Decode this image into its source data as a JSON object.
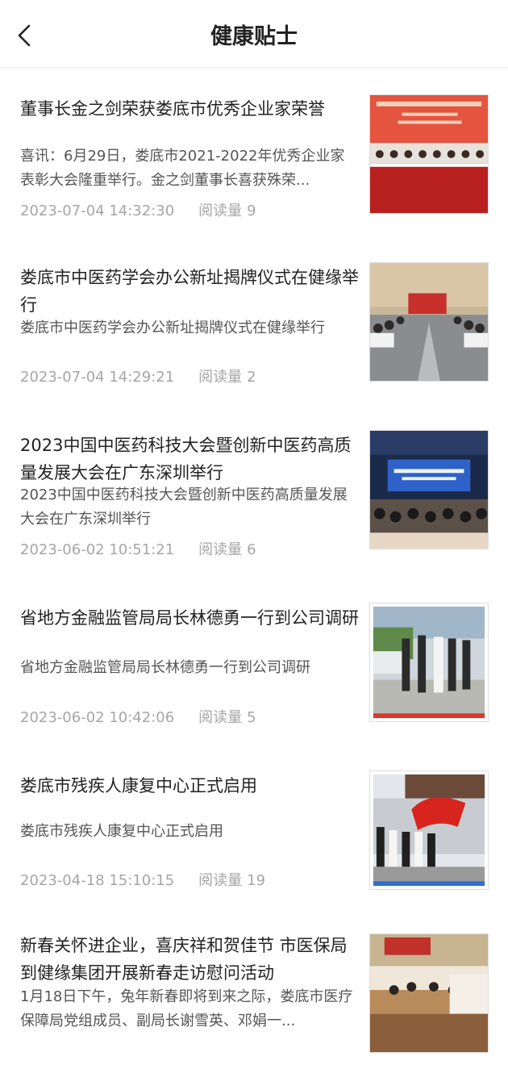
{
  "header": {
    "title": "健康贴士",
    "back_icon": "chevron-left-icon"
  },
  "articles": [
    {
      "title": "董事长金之剑荣获娄底市优秀企业家荣誉",
      "summary": "喜讯：6月29日，娄底市2021-2022年优秀企业家表彰大会隆重举行。金之剑董事长喜获殊荣...",
      "date": "2023-07-04 14:32:30",
      "reads_label": "阅读量",
      "reads": "9"
    },
    {
      "title": "娄底市中医药学会办公新址揭牌仪式在健缘举行",
      "summary": "娄底市中医药学会办公新址揭牌仪式在健缘举行",
      "date": "2023-07-04 14:29:21",
      "reads_label": "阅读量",
      "reads": "2"
    },
    {
      "title": "2023中国中医药科技大会暨创新中医药高质量发展大会在广东深圳举行",
      "summary": "2023中国中医药科技大会暨创新中医药高质量发展大会在广东深圳举行",
      "date": "2023-06-02 10:51:21",
      "reads_label": "阅读量",
      "reads": "6"
    },
    {
      "title": "省地方金融监管局局长林德勇一行到公司调研",
      "summary": "省地方金融监管局局长林德勇一行到公司调研",
      "date": "2023-06-02 10:42:06",
      "reads_label": "阅读量",
      "reads": "5"
    },
    {
      "title": "娄底市残疾人康复中心正式启用",
      "summary": "娄底市残疾人康复中心正式启用",
      "date": "2023-04-18 15:10:15",
      "reads_label": "阅读量",
      "reads": "19"
    },
    {
      "title": "新春关怀进企业，喜庆祥和贺佳节 市医保局到健缘集团开展新春走访慰问活动",
      "summary": "1月18日下午，兔年新春即将到来之际，娄底市医疗保障局党组成员、副局长谢雪英、邓娟一...",
      "date": "",
      "reads_label": "",
      "reads": ""
    }
  ]
}
